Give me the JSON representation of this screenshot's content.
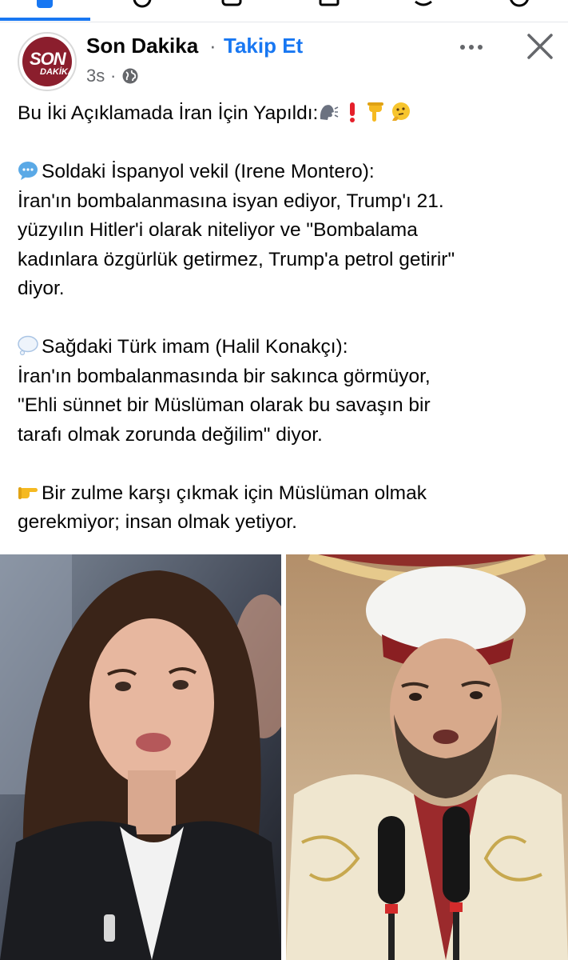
{
  "post": {
    "page_name": "Son Dakika",
    "name_separator": "·",
    "follow_label": "Takip Et",
    "time": "3s",
    "meta_separator": "·",
    "avatar_text_top": "SON",
    "avatar_text_bottom": "DAKİKA",
    "lines": {
      "title": "Bu İki Açıklamada İran İçin Yapıldı:",
      "left_heading": "Soldaki İspanyol vekil (Irene Montero):",
      "left_1": "İran'ın bombalanmasına isyan ediyor, Trump'ı 21.",
      "left_2": "yüzyılın Hitler'i olarak niteliyor ve \"Bombalama",
      "left_3": "kadınlara özgürlük getirmez, Trump'a petrol getirir\"",
      "left_4": "diyor.",
      "right_heading": "Sağdaki Türk imam (Halil Konakçı):",
      "right_1": "İran'ın bombalanmasında bir sakınca görmüyor,",
      "right_2": "\"Ehli sünnet bir Müslüman olarak bu savaşın bir",
      "right_3": "tarafı olmak zorunda değilim\" diyor.",
      "closing_1": "Bir zulme karşı çıkmak için Müslüman olmak",
      "closing_2": "gerekmiyor; insan olmak yetiyor."
    }
  },
  "icons": {
    "title_emojis": [
      "speaking-head-icon",
      "exclamation-icon",
      "pointing-down-icon",
      "thinking-face-icon"
    ],
    "left_marker": "speech-bubble-icon",
    "right_marker": "thought-bubble-icon",
    "closing_marker": "pointing-right-icon"
  },
  "colors": {
    "accent": "#1877f2",
    "secondary_text": "#65676b",
    "brand": "#8b1e2d"
  }
}
